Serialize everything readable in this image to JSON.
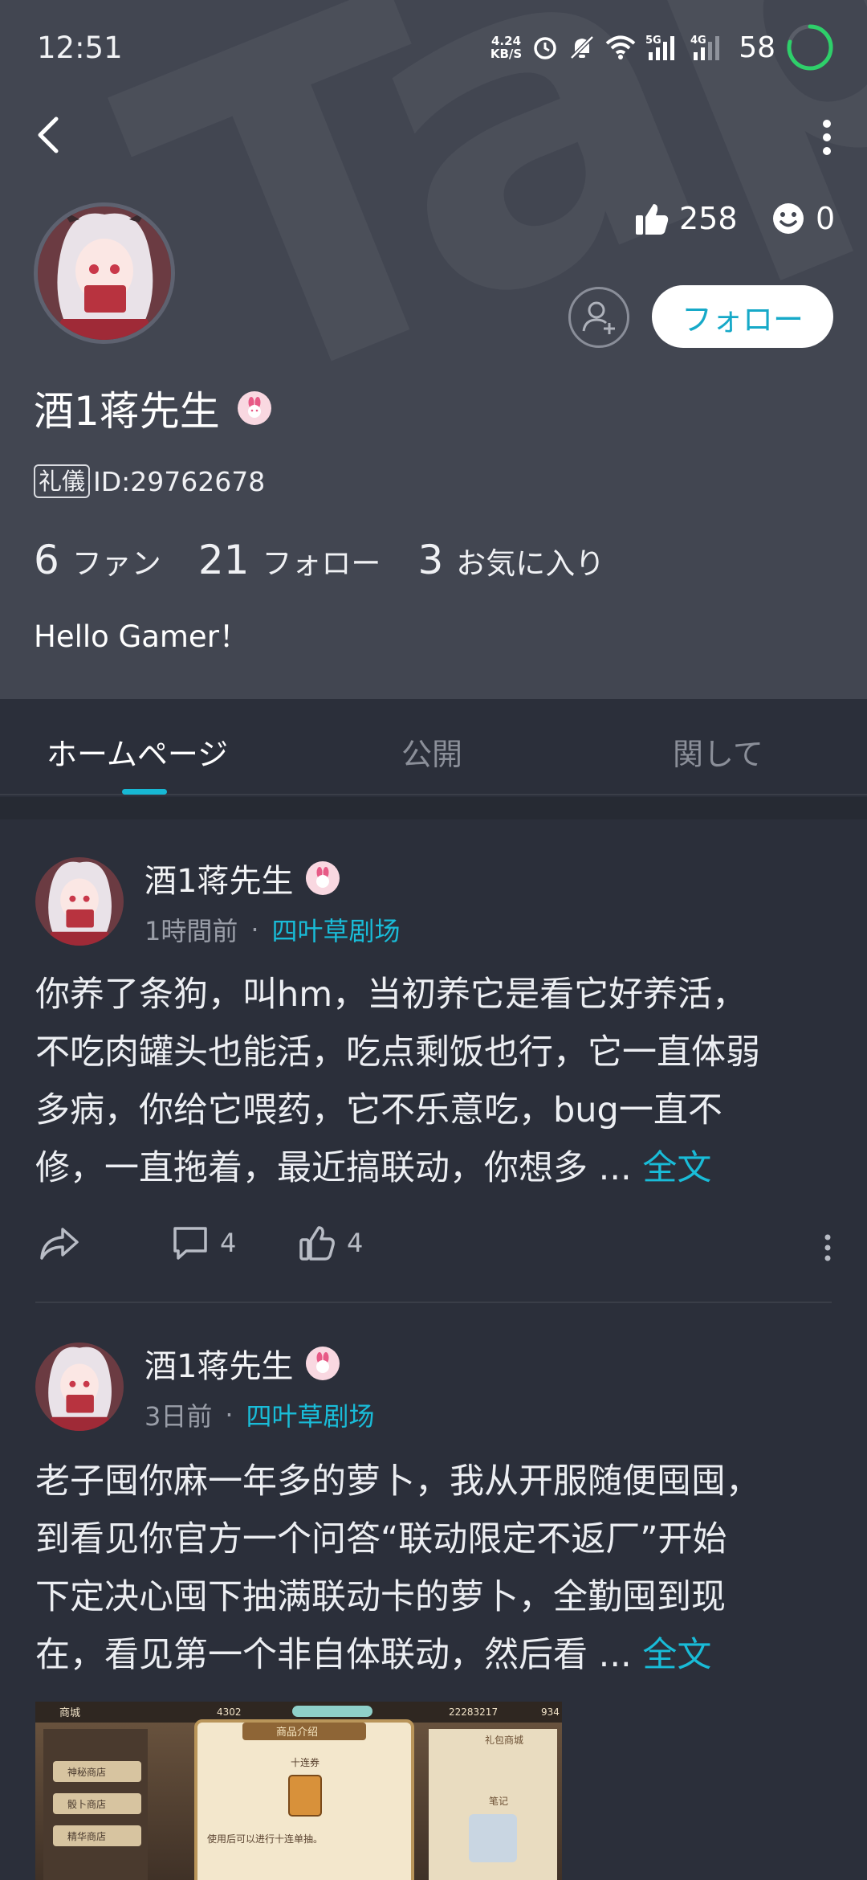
{
  "status": {
    "time": "12:51",
    "net_speed_value": "4.24",
    "net_speed_unit": "KB/S",
    "battery": "58",
    "icons": [
      "alarm-icon",
      "mute-icon",
      "wifi-icon",
      "signal-5g-icon",
      "signal-4g-icon",
      "battery-ring-icon"
    ]
  },
  "profile": {
    "name": "酒1蒋先生",
    "likes": "258",
    "emoji_count": "0",
    "follow_label": "フォロー",
    "id_tag": "礼儀",
    "id": "ID:29762678",
    "fans_count": "6",
    "fans_label": "ファン",
    "following_count": "21",
    "following_label": "フォロー",
    "favorites_count": "3",
    "favorites_label": "お気に入り",
    "bio": "Hello Gamer！",
    "watermark": "TapTap"
  },
  "tabs": [
    {
      "label": "ホームページ",
      "active": true
    },
    {
      "label": "公開",
      "active": false
    },
    {
      "label": "関して",
      "active": false
    }
  ],
  "posts": [
    {
      "author": "酒1蒋先生",
      "time": "1時間前",
      "dot": "·",
      "forum": "四叶草剧场",
      "lines": [
        "你养了条狗，叫hm，当初养它是看它好养活，",
        "不吃肉罐头也能活，吃点剩饭也行，它一直体弱",
        "多病，你给它喂药，它不乐意吃，bug一直不",
        "修，一直拖着，最近搞联动，你想多 ..."
      ],
      "more_label": "全文",
      "comments": "4",
      "likes": "4"
    },
    {
      "author": "酒1蒋先生",
      "time": "3日前",
      "dot": "·",
      "forum": "四叶草剧场",
      "lines": [
        "老子囤你麻一年多的萝卜，我从开服随便囤囤，",
        "到看见你官方一个问答“联动限定不返厂”开始",
        "下定决心囤下抽满联动卡的萝卜，全勤囤到现",
        "在，看见第一个非自体联动，然后看 ..."
      ],
      "more_label": "全文",
      "image": {
        "top_values": [
          "4302",
          "22283217",
          "934"
        ],
        "shop_title": "商城",
        "panel_title": "商品介绍",
        "item_name": "十连券",
        "item_desc": "使用后可以进行十连单抽。",
        "menu": [
          "神秘商店",
          "骰卜商店",
          "精华商店"
        ],
        "right_tab": "礼包商城",
        "right_label": "笔记"
      }
    }
  ],
  "colors": {
    "accent": "#17b8d4",
    "header_bg": "#424651",
    "page_bg": "#2b2f3a"
  }
}
